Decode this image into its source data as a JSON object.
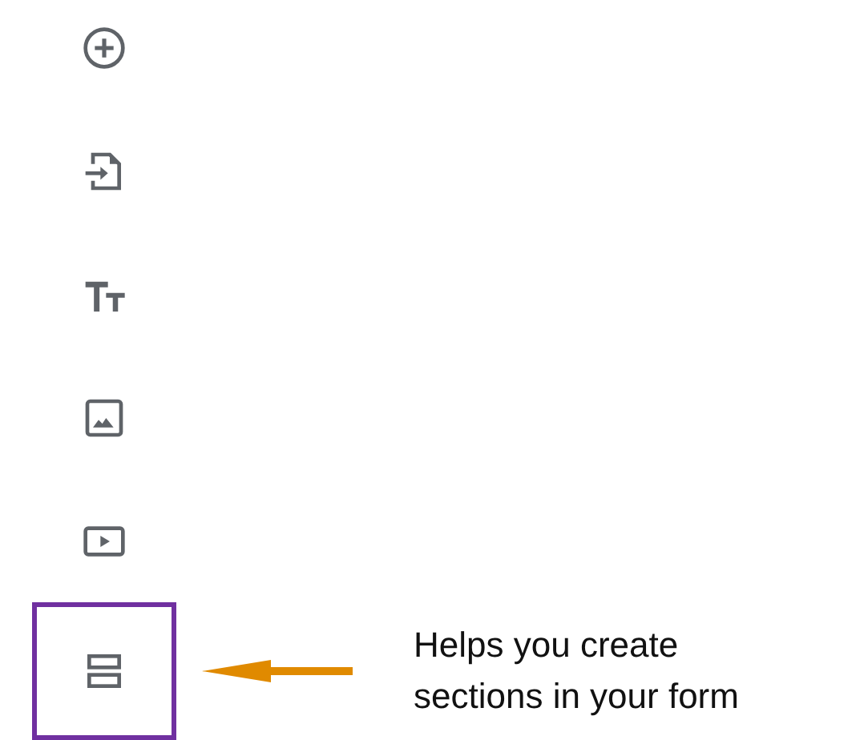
{
  "toolbar": {
    "tools": [
      {
        "kind": "add-question",
        "highlighted": false
      },
      {
        "kind": "import-questions",
        "highlighted": false
      },
      {
        "kind": "title-text",
        "highlighted": false
      },
      {
        "kind": "image",
        "highlighted": false
      },
      {
        "kind": "video",
        "highlighted": false
      },
      {
        "kind": "section",
        "highlighted": true,
        "callout": "Helps you create sections in your form"
      }
    ]
  }
}
